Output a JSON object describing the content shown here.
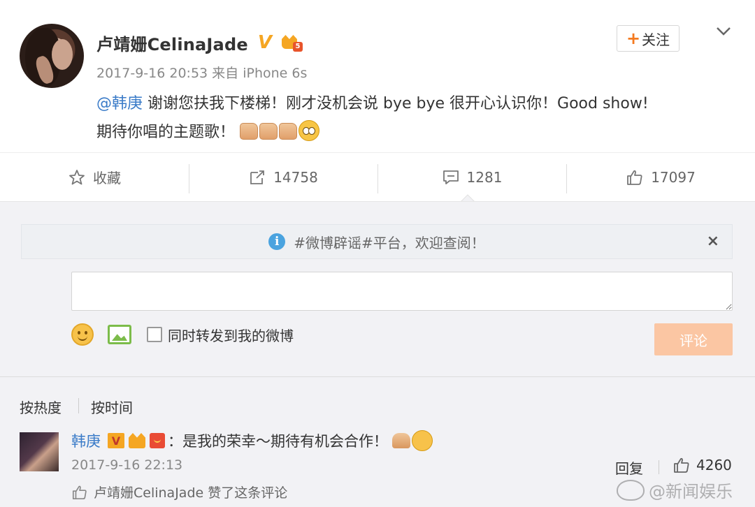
{
  "post": {
    "author": "卢靖姗CelinaJade",
    "verified_mark": "V",
    "level": "5",
    "meta": "2017-9-16 20:53 来自 iPhone 6s",
    "mention": "@韩庚",
    "text_line1": " 谢谢您扶我下楼梯！刚才没机会说 bye bye 很开心认识你！Good show!",
    "text_line2": "期待你唱的主题歌！",
    "follow_label": "关注",
    "follow_plus": "+"
  },
  "actions": {
    "favorite_label": "收藏",
    "repost_count": "14758",
    "comment_count": "1281",
    "like_count": "17097"
  },
  "comments": {
    "notice": "#微博辟谣#平台，欢迎查阅！",
    "close_symbol": "×",
    "input_value": "",
    "repost_checkbox_label": "同时转发到我的微博",
    "submit_label": "评论",
    "sort_hot": "按热度",
    "sort_time": "按时间",
    "items": [
      {
        "name": "韩庚",
        "v_mark": "V",
        "text": "：是我的荣幸～期待有机会合作！",
        "time": "2017-9-16 22:13",
        "reply_label": "回复",
        "like_count": "4260",
        "liked_by": "卢靖姗CelinaJade 赞了这条评论"
      }
    ]
  },
  "watermark": "@新闻娱乐",
  "colors": {
    "link": "#3a7bc8",
    "vip": "#f5a623",
    "submit_disabled": "#fbc6a3",
    "comment_bg": "#f2f2f5"
  }
}
